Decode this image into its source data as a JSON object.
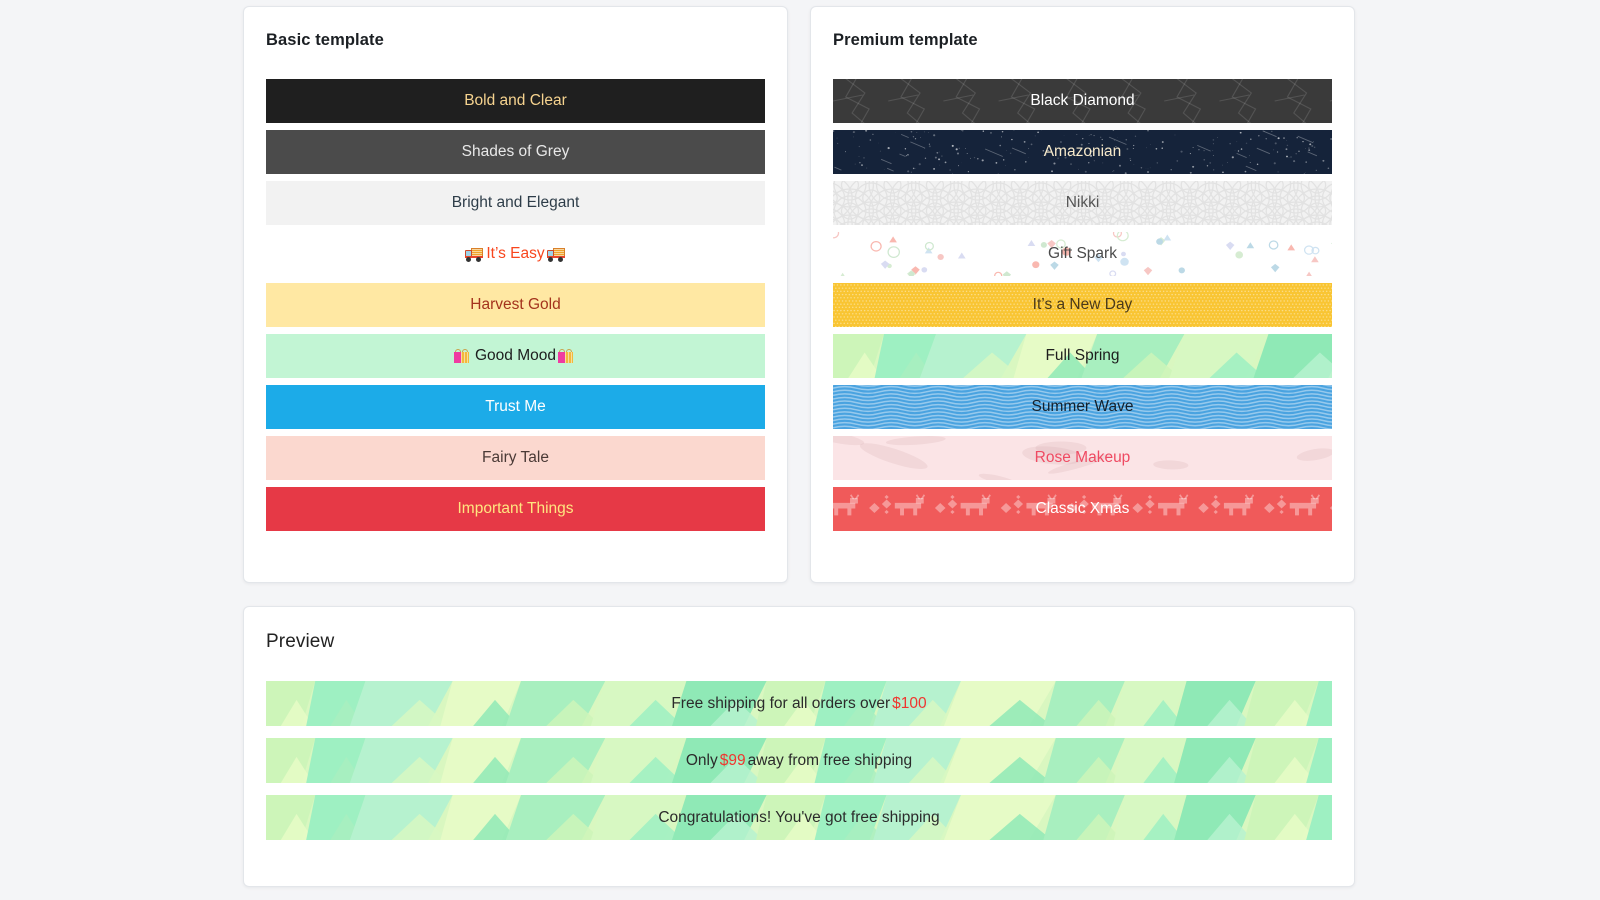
{
  "page": {
    "background_color": "#f4f5f7"
  },
  "basic_card": {
    "title": "Basic template",
    "themes": [
      {
        "name": "Bold and Clear",
        "label": "Bold and Clear",
        "background_color": "#1f1f1f",
        "text_color": "#f6d38f",
        "pattern": "none"
      },
      {
        "name": "Shades of Grey",
        "label": "Shades of Grey",
        "background_color": "#4b4b4b",
        "text_color": "#e8e8e8",
        "pattern": "none"
      },
      {
        "name": "Bright and Elegant",
        "label": "Bright and Elegant",
        "background_color": "#f2f2f2",
        "text_color": "#2e3d49",
        "pattern": "none"
      },
      {
        "name": "It's Easy",
        "label": "It’s Easy",
        "background_color": "#ffffff",
        "text_color": "#f8461e",
        "pattern": "none",
        "emoji_left": "delivery-truck",
        "emoji_right": "delivery-truck"
      },
      {
        "name": "Harvest Gold",
        "label": "Harvest Gold",
        "background_color": "#ffe8a3",
        "text_color": "#a3331d",
        "pattern": "none"
      },
      {
        "name": "Good Mood",
        "label": "Good Mood",
        "background_color": "#c2f5d4",
        "text_color": "#1d1d1d",
        "pattern": "none",
        "emoji_left": "shopping-bags",
        "emoji_right": "shopping-bags"
      },
      {
        "name": "Trust Me",
        "label": "Trust Me",
        "background_color": "#1cabe8",
        "text_color": "#ffffff",
        "pattern": "none"
      },
      {
        "name": "Fairy Tale",
        "label": "Fairy Tale",
        "background_color": "#fbd8cf",
        "text_color": "#4a3a36",
        "pattern": "none"
      },
      {
        "name": "Important Things",
        "label": "Important Things",
        "background_color": "#e63946",
        "text_color": "#ffe680",
        "pattern": "none"
      }
    ]
  },
  "premium_card": {
    "title": "Premium template",
    "themes": [
      {
        "name": "Black Diamond",
        "label": "Black Diamond",
        "background_color": "#3a3a3a",
        "text_color": "#ffffff",
        "pattern": "faceted-polygons"
      },
      {
        "name": "Amazonian",
        "label": "Amazonian",
        "background_color": "#15233a",
        "text_color": "#f7eacb",
        "pattern": "starfield"
      },
      {
        "name": "Nikki",
        "label": "Nikki",
        "background_color": "#f2f2f2",
        "text_color": "#555555",
        "pattern": "seigaiha-waves"
      },
      {
        "name": "Gift Spark",
        "label": "Gift Spark",
        "background_color": "#ffffff",
        "text_color": "#4a4a4a",
        "pattern": "confetti-shapes"
      },
      {
        "name": "It's a New Day",
        "label": "It’s a New Day",
        "background_color": "#f9c533",
        "text_color": "#4a3a1a",
        "pattern": "dotted-grid"
      },
      {
        "name": "Full Spring",
        "label": "Full Spring",
        "background_color": "#d9f7c0",
        "text_color": "#1d1d1d",
        "pattern": "low-poly-green"
      },
      {
        "name": "Summer Wave",
        "label": "Summer Wave",
        "background_color": "#4aa3e0",
        "text_color": "#14202b",
        "pattern": "wavy-lines"
      },
      {
        "name": "Rose Makeup",
        "label": "Rose Makeup",
        "background_color": "#fbe4e6",
        "text_color": "#ef4a62",
        "pattern": "brush-strokes"
      },
      {
        "name": "Classic Xmas",
        "label": "Classic Xmas",
        "background_color": "#f05a5a",
        "text_color": "#ffffff",
        "pattern": "reindeer-knit"
      }
    ]
  },
  "preview_card": {
    "title": "Preview",
    "theme_name": "Full Spring",
    "background_color": "#d9f7c0",
    "text_color": "#2b2b2b",
    "accent_color": "#f0362f",
    "messages": [
      {
        "prefix": "Free shipping for all orders over ",
        "amount": "$100",
        "suffix": ""
      },
      {
        "prefix": "Only ",
        "amount": "$99",
        "suffix": " away from free shipping"
      },
      {
        "prefix": "Congratulations! You've got free shipping",
        "amount": "",
        "suffix": ""
      }
    ]
  }
}
